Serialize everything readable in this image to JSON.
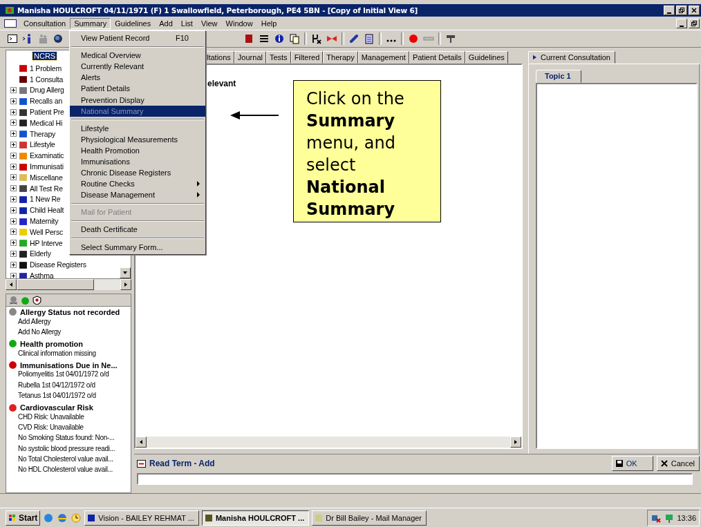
{
  "window": {
    "title": "Manisha HOULCROFT 04/11/1971 (F)  1 Swallowfield, Peterborough, PE4 5BN - [Copy of Initial View 6]"
  },
  "menubar": [
    {
      "label": "Consultation",
      "selected": false
    },
    {
      "label": "Summary",
      "selected": true
    },
    {
      "label": "Guidelines",
      "selected": false
    },
    {
      "label": "Add",
      "selected": false
    },
    {
      "label": "List",
      "selected": false
    },
    {
      "label": "View",
      "selected": false
    },
    {
      "label": "Window",
      "selected": false
    },
    {
      "label": "Help",
      "selected": false
    }
  ],
  "summary_menu": [
    {
      "kind": "item",
      "label": "View Patient Record",
      "shortcut": "F10",
      "selected": false,
      "disabled": false
    },
    {
      "kind": "separator"
    },
    {
      "kind": "item",
      "label": "Medical Overview",
      "selected": false,
      "disabled": false
    },
    {
      "kind": "item",
      "label": "Currently Relevant",
      "selected": false,
      "disabled": false
    },
    {
      "kind": "item",
      "label": "Alerts",
      "selected": false,
      "disabled": false
    },
    {
      "kind": "item",
      "label": "Patient Details",
      "selected": false,
      "disabled": false
    },
    {
      "kind": "item",
      "label": "Prevention Display",
      "selected": false,
      "disabled": false
    },
    {
      "kind": "item",
      "label": "National Summary",
      "selected": true,
      "disabled": true
    },
    {
      "kind": "separator"
    },
    {
      "kind": "item",
      "label": "Lifestyle",
      "selected": false,
      "disabled": false
    },
    {
      "kind": "item",
      "label": "Physiological Measurements",
      "selected": false,
      "disabled": false
    },
    {
      "kind": "item",
      "label": "Health Promotion",
      "selected": false,
      "disabled": false
    },
    {
      "kind": "item",
      "label": "Immunisations",
      "selected": false,
      "disabled": false
    },
    {
      "kind": "item",
      "label": "Chronic Disease Registers",
      "selected": false,
      "disabled": false
    },
    {
      "kind": "submenu",
      "label": "Routine Checks",
      "selected": false,
      "disabled": false
    },
    {
      "kind": "submenu",
      "label": "Disease Management",
      "selected": false,
      "disabled": false
    },
    {
      "kind": "separator"
    },
    {
      "kind": "item",
      "label": "Mail for Patient",
      "selected": false,
      "disabled": true
    },
    {
      "kind": "separator"
    },
    {
      "kind": "item",
      "label": "Death Certificate",
      "selected": false,
      "disabled": false
    },
    {
      "kind": "separator"
    },
    {
      "kind": "item",
      "label": "Select Summary Form...",
      "selected": false,
      "disabled": false
    }
  ],
  "tree": {
    "root": {
      "label": "NCRS",
      "selected": true
    },
    "items": [
      {
        "label": "1 Problem",
        "expandable": false
      },
      {
        "label": "1 Consulta",
        "expandable": false
      },
      {
        "label": "Drug Allerg",
        "expandable": true
      },
      {
        "label": "Recalls an",
        "expandable": true
      },
      {
        "label": "Patient Pre",
        "expandable": true
      },
      {
        "label": "Medical Hi",
        "expandable": true
      },
      {
        "label": "Therapy",
        "expandable": true
      },
      {
        "label": "Lifestyle",
        "expandable": true
      },
      {
        "label": "Examinatic",
        "expandable": true
      },
      {
        "label": "Immunisati",
        "expandable": true
      },
      {
        "label": "Miscellane",
        "expandable": true
      },
      {
        "label": "All Test Re",
        "expandable": true
      },
      {
        "label": "1 New Re",
        "expandable": true
      },
      {
        "label": "Child Healt",
        "expandable": true
      },
      {
        "label": "Maternity",
        "expandable": true
      },
      {
        "label": "Well Persc",
        "expandable": true
      },
      {
        "label": "HP Interve",
        "expandable": true
      },
      {
        "label": "Elderly",
        "expandable": true
      },
      {
        "label": "Disease Registers",
        "expandable": true
      },
      {
        "label": "Asthma",
        "expandable": true
      }
    ]
  },
  "alerts": [
    {
      "kind": "heading",
      "label": "Allergy Status not recorded"
    },
    {
      "kind": "item",
      "label": "Add Allergy"
    },
    {
      "kind": "item",
      "label": "Add No Allergy"
    },
    {
      "kind": "heading",
      "label": "Health promotion"
    },
    {
      "kind": "item",
      "label": "Clinical information missing"
    },
    {
      "kind": "heading",
      "label": "Immunisations Due in Ne..."
    },
    {
      "kind": "item",
      "label": "Poliomyelitis 1st 04/01/1972  o/d"
    },
    {
      "kind": "item",
      "label": "Rubella 1st 04/12/1972  o/d"
    },
    {
      "kind": "item",
      "label": "Tetanus 1st 04/01/1972  o/d"
    },
    {
      "kind": "heading",
      "label": "Cardiovascular Risk"
    },
    {
      "kind": "item",
      "label": "CHD Risk: Unavailable"
    },
    {
      "kind": "item",
      "label": "CVD Risk: Unavailable"
    },
    {
      "kind": "item",
      "label": "No Smoking Status found: Non-..."
    },
    {
      "kind": "item",
      "label": "No systolic blood pressure readi..."
    },
    {
      "kind": "item",
      "label": "No Total Cholesterol value avail..."
    },
    {
      "kind": "item",
      "label": "No HDL Cholesterol value avail..."
    }
  ],
  "record_tabs": [
    {
      "label": "ltations",
      "selected": false
    },
    {
      "label": "Journal",
      "selected": false
    },
    {
      "label": "Tests",
      "selected": false
    },
    {
      "label": "Filtered",
      "selected": false
    },
    {
      "label": "Therapy",
      "selected": false
    },
    {
      "label": "Management",
      "selected": false
    },
    {
      "label": "Patient Details",
      "selected": false
    },
    {
      "label": "Guidelines",
      "selected": false
    }
  ],
  "record_heading": "elevant",
  "callout": "Click on the **Summary** menu, and select **National Summary**",
  "consultation": {
    "tab": "Current Consultation",
    "topic_tab": "Topic 1"
  },
  "read_term": {
    "title": "Read Term - Add",
    "ok": "OK",
    "cancel": "Cancel"
  },
  "taskbar": {
    "start": "Start",
    "tasks": [
      {
        "label": "Vision - BAILEY REHMAT ...",
        "selected": false
      },
      {
        "label": "Manisha HOULCROFT ...",
        "selected": true
      },
      {
        "label": "Dr Bill Bailey - Mail Manager",
        "selected": false
      }
    ],
    "time": "13:36"
  }
}
